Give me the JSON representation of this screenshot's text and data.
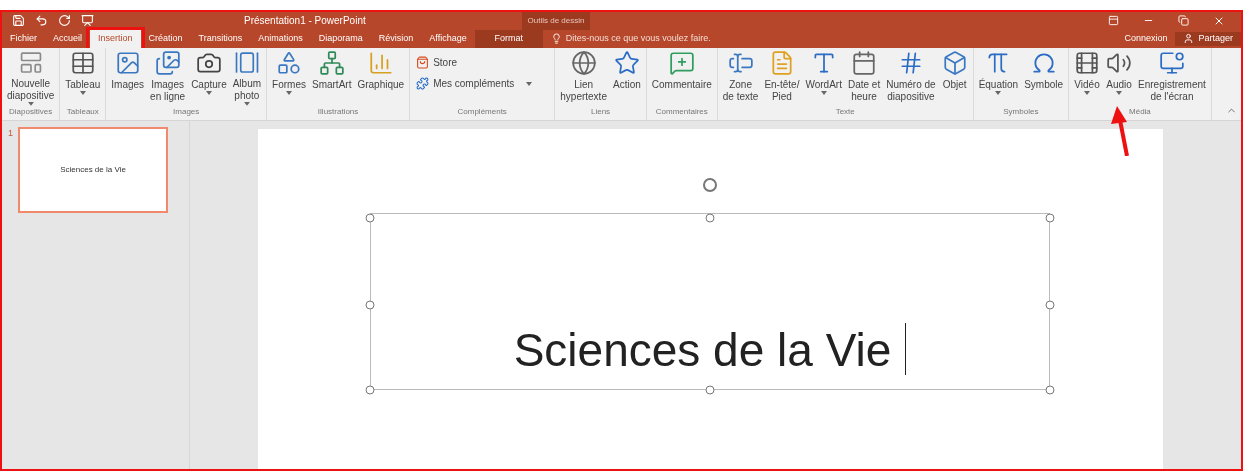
{
  "title_bar": {
    "title": "Présentation1 - PowerPoint",
    "context_group": "Outils de dessin"
  },
  "tabs": [
    {
      "label": "Fichier",
      "selected": false,
      "kind": "file",
      "callout": false
    },
    {
      "label": "Accueil",
      "selected": false,
      "kind": "normal",
      "callout": false
    },
    {
      "label": "Insertion",
      "selected": true,
      "kind": "normal",
      "callout": true
    },
    {
      "label": "Création",
      "selected": false,
      "kind": "normal",
      "callout": false
    },
    {
      "label": "Transitions",
      "selected": false,
      "kind": "normal",
      "callout": false
    },
    {
      "label": "Animations",
      "selected": false,
      "kind": "normal",
      "callout": false
    },
    {
      "label": "Diaporama",
      "selected": false,
      "kind": "normal",
      "callout": false
    },
    {
      "label": "Révision",
      "selected": false,
      "kind": "normal",
      "callout": false
    },
    {
      "label": "Affichage",
      "selected": false,
      "kind": "normal",
      "callout": false
    },
    {
      "label": "Format",
      "selected": false,
      "kind": "contextual",
      "callout": false
    }
  ],
  "tell_me": {
    "placeholder": "Dites-nous ce que vous voulez faire."
  },
  "account": {
    "sign_in": "Connexion",
    "share": "Partager"
  },
  "ribbon_groups": [
    {
      "label": "Diapositives",
      "commands": [
        {
          "kind": "large",
          "lines": [
            "Nouvelle",
            "diapositive"
          ],
          "dropdown": true,
          "callout": false
        }
      ]
    },
    {
      "label": "Tableaux",
      "commands": [
        {
          "kind": "large",
          "lines": [
            "Tableau"
          ],
          "dropdown": true,
          "callout": false
        }
      ]
    },
    {
      "label": "Images",
      "commands": [
        {
          "kind": "large",
          "lines": [
            "Images"
          ],
          "dropdown": false,
          "callout": false
        },
        {
          "kind": "large",
          "lines": [
            "Images",
            "en ligne"
          ],
          "dropdown": false,
          "callout": false
        },
        {
          "kind": "large",
          "lines": [
            "Capture"
          ],
          "dropdown": true,
          "callout": false
        },
        {
          "kind": "large",
          "lines": [
            "Album",
            "photo"
          ],
          "dropdown": true,
          "callout": false
        }
      ]
    },
    {
      "label": "Illustrations",
      "commands": [
        {
          "kind": "large",
          "lines": [
            "Formes"
          ],
          "dropdown": true,
          "callout": false
        },
        {
          "kind": "large",
          "lines": [
            "SmartArt"
          ],
          "dropdown": false,
          "callout": false
        },
        {
          "kind": "large",
          "lines": [
            "Graphique"
          ],
          "dropdown": false,
          "callout": false
        }
      ]
    },
    {
      "label": "Compléments",
      "commands": [
        {
          "kind": "small",
          "lines": [
            "Store"
          ],
          "dropdown": false,
          "callout": false
        },
        {
          "kind": "small",
          "lines": [
            "Mes compléments"
          ],
          "dropdown": true,
          "callout": false
        }
      ]
    },
    {
      "label": "Liens",
      "commands": [
        {
          "kind": "large",
          "lines": [
            "Lien",
            "hypertexte"
          ],
          "dropdown": false,
          "callout": false
        },
        {
          "kind": "large",
          "lines": [
            "Action"
          ],
          "dropdown": false,
          "callout": false
        }
      ]
    },
    {
      "label": "Commentaires",
      "commands": [
        {
          "kind": "large",
          "lines": [
            "Commentaire"
          ],
          "dropdown": false,
          "callout": false
        }
      ]
    },
    {
      "label": "Texte",
      "commands": [
        {
          "kind": "large",
          "lines": [
            "Zone",
            "de texte"
          ],
          "dropdown": false,
          "callout": false
        },
        {
          "kind": "large",
          "lines": [
            "En-tête/",
            "Pied"
          ],
          "dropdown": false,
          "callout": false
        },
        {
          "kind": "large",
          "lines": [
            "WordArt"
          ],
          "dropdown": true,
          "callout": false
        },
        {
          "kind": "large",
          "lines": [
            "Date et",
            "heure"
          ],
          "dropdown": false,
          "callout": false
        },
        {
          "kind": "large",
          "lines": [
            "Numéro de",
            "diapositive"
          ],
          "dropdown": false,
          "callout": false
        },
        {
          "kind": "large",
          "lines": [
            "Objet"
          ],
          "dropdown": false,
          "callout": false
        }
      ]
    },
    {
      "label": "Symboles",
      "commands": [
        {
          "kind": "large",
          "lines": [
            "Équation"
          ],
          "dropdown": true,
          "callout": false
        },
        {
          "kind": "large",
          "lines": [
            "Symbole"
          ],
          "dropdown": false,
          "callout": false
        }
      ]
    },
    {
      "label": "Média",
      "commands": [
        {
          "kind": "large",
          "lines": [
            "Vidéo"
          ],
          "dropdown": true,
          "callout": false
        },
        {
          "kind": "large",
          "lines": [
            "Audio"
          ],
          "dropdown": true,
          "callout": true
        },
        {
          "kind": "large",
          "lines": [
            "Enregistrement",
            "de l'écran"
          ],
          "dropdown": false,
          "callout": false
        }
      ]
    }
  ],
  "slides_pane": [
    {
      "number": "1",
      "selected": true,
      "title": "Sciences de la Vie"
    }
  ],
  "slide": {
    "title": "Sciences de la Vie"
  }
}
